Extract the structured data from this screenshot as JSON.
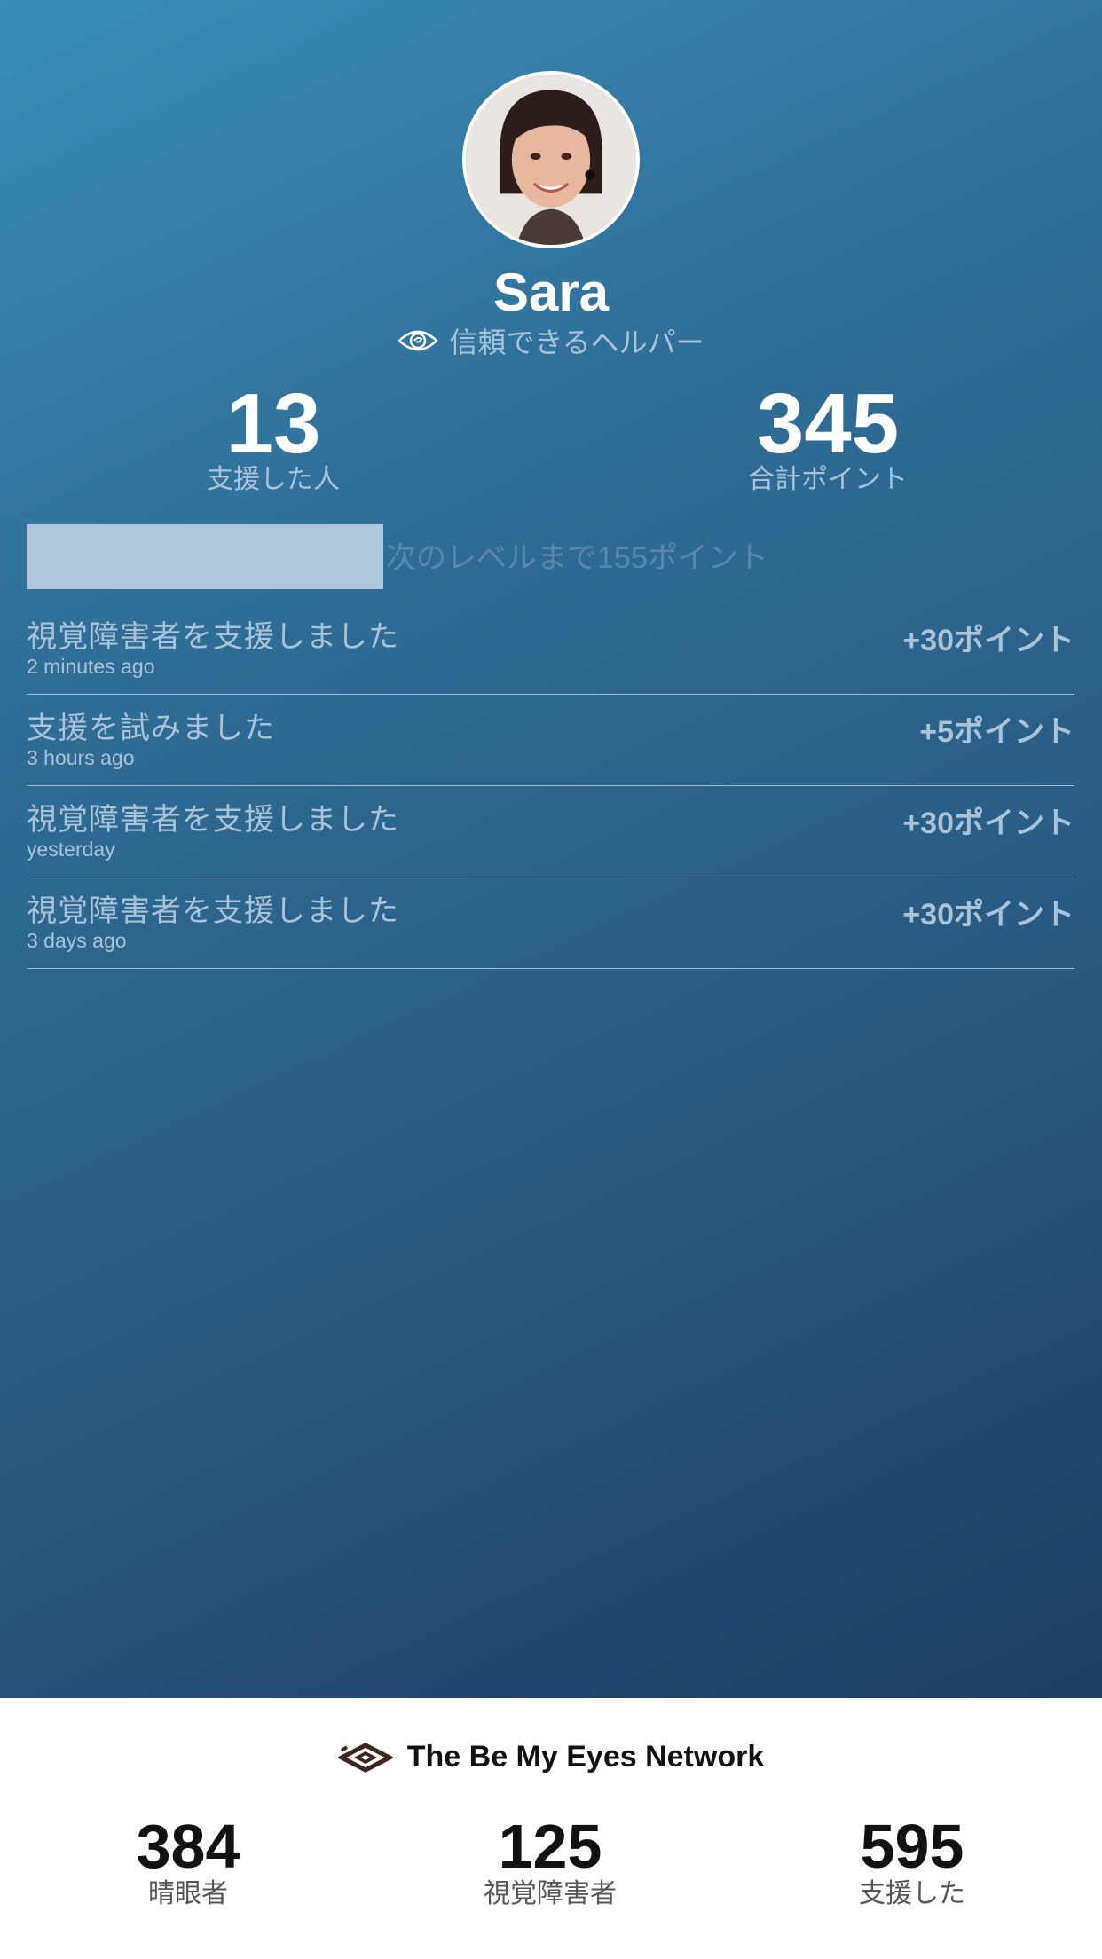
{
  "profile": {
    "name": "Sara",
    "role_label": "信頼できるヘルパー",
    "stats": {
      "helped_value": "13",
      "helped_label": "支援した人",
      "points_value": "345",
      "points_label": "合計ポイント"
    },
    "progress": {
      "label": "次のレベルまで155ポイント",
      "fraction": 0.34
    }
  },
  "activity": [
    {
      "title": "視覚障害者を支援しました",
      "time": "2 minutes ago",
      "points": "+30ポイント"
    },
    {
      "title": "支援を試みました",
      "time": "3 hours ago",
      "points": "+5ポイント"
    },
    {
      "title": "視覚障害者を支援しました",
      "time": "yesterday",
      "points": "+30ポイント"
    },
    {
      "title": "視覚障害者を支援しました",
      "time": "3 days ago",
      "points": "+30ポイント"
    }
  ],
  "network": {
    "title": "The Be My Eyes Network",
    "stats": [
      {
        "value": "384",
        "label": "晴眼者"
      },
      {
        "value": "125",
        "label": "視覚障害者"
      },
      {
        "value": "595",
        "label": "支援した"
      }
    ]
  },
  "icons": {
    "avatar": "avatar-photo",
    "role": "eye-icon",
    "logo": "be-my-eyes-logo-icon"
  },
  "colors": {
    "gradient_top": "#3a8db8",
    "gradient_bottom": "#1f3c63",
    "muted_text": "#a9c3d8",
    "progress_fill": "#afc7d9"
  }
}
